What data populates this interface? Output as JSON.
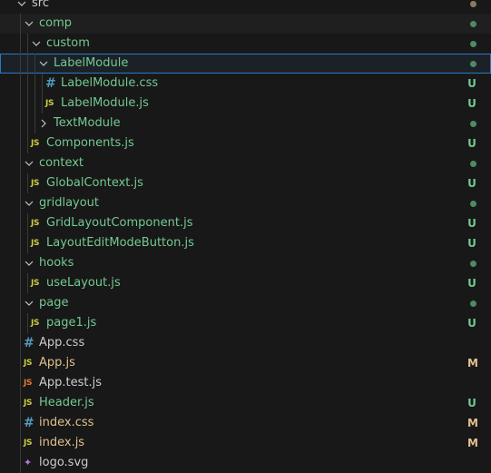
{
  "explorer": {
    "items": [
      {
        "label": "src",
        "status": "",
        "kind": "folder"
      },
      {
        "label": "comp",
        "status": "",
        "kind": "folder"
      },
      {
        "label": "custom",
        "status": "",
        "kind": "folder"
      },
      {
        "label": "LabelModule",
        "status": "",
        "kind": "folder"
      },
      {
        "label": "LabelModule.css",
        "icon": "#",
        "status": "U"
      },
      {
        "label": "LabelModule.js",
        "icon": "JS",
        "status": "U"
      },
      {
        "label": "TextModule",
        "status": "",
        "kind": "folder"
      },
      {
        "label": "Components.js",
        "icon": "JS",
        "status": "U"
      },
      {
        "label": "context",
        "status": "",
        "kind": "folder"
      },
      {
        "label": "GlobalContext.js",
        "icon": "JS",
        "status": "U"
      },
      {
        "label": "gridlayout",
        "status": "",
        "kind": "folder"
      },
      {
        "label": "GridLayoutComponent.js",
        "icon": "JS",
        "status": "U"
      },
      {
        "label": "LayoutEditModeButton.js",
        "icon": "JS",
        "status": "U"
      },
      {
        "label": "hooks",
        "status": "",
        "kind": "folder"
      },
      {
        "label": "useLayout.js",
        "icon": "JS",
        "status": "U"
      },
      {
        "label": "page",
        "status": "",
        "kind": "folder"
      },
      {
        "label": "page1.js",
        "icon": "JS",
        "status": "U"
      },
      {
        "label": "App.css",
        "icon": "#",
        "status": ""
      },
      {
        "label": "App.js",
        "icon": "JS",
        "status": "M"
      },
      {
        "label": "App.test.js",
        "icon": "JS",
        "status": ""
      },
      {
        "label": "Header.js",
        "icon": "JS",
        "status": "U"
      },
      {
        "label": "index.css",
        "icon": "#",
        "status": "M"
      },
      {
        "label": "index.js",
        "icon": "JS",
        "status": "M"
      },
      {
        "label": "logo.svg",
        "status": ""
      }
    ]
  },
  "colors": {
    "untracked": "#73c991",
    "modified": "#e2c08d",
    "selection_border": "#2b79c2",
    "js_icon": "#cbcb41",
    "css_icon": "#519aba"
  }
}
